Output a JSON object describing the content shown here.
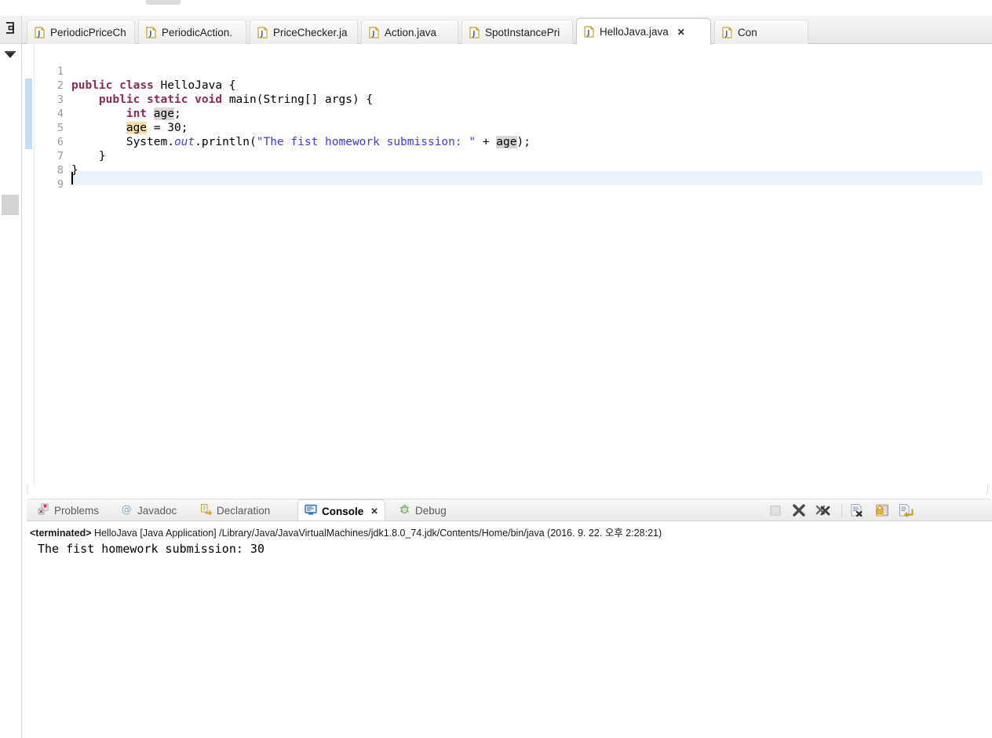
{
  "window": {
    "left_bar": {
      "restore_icon": "restore-view-icon",
      "chevron_icon": "chevron-down-icon"
    }
  },
  "editor": {
    "tabs": [
      {
        "label": "PeriodicPriceCh",
        "icon": "java-file-icon",
        "active": false,
        "closable": false
      },
      {
        "label": "PeriodicAction.",
        "icon": "java-file-icon",
        "active": false,
        "closable": false
      },
      {
        "label": "PriceChecker.ja",
        "icon": "java-file-icon",
        "active": false,
        "closable": false
      },
      {
        "label": "Action.java",
        "icon": "java-file-icon",
        "active": false,
        "closable": false
      },
      {
        "label": "SpotInstancePri",
        "icon": "java-file-icon",
        "active": false,
        "closable": false
      },
      {
        "label": "HelloJava.java",
        "icon": "java-file-icon",
        "active": true,
        "closable": true
      },
      {
        "label": "Con",
        "icon": "java-file-icon",
        "active": false,
        "closable": false
      }
    ],
    "close_glyph": "✕",
    "line_numbers": [
      "1",
      "2",
      "3",
      "4",
      "5",
      "6",
      "7",
      "8",
      "9"
    ],
    "fold_marker_line": "3",
    "code_lines": [
      "",
      "public class HelloJava {",
      "    public static void main(String[] args) {",
      "        int age;",
      "        age = 30;",
      "        System.out.println(\"The fist homework submission: \" + age);",
      "    }",
      "}",
      ""
    ],
    "current_line": "9"
  },
  "console_panel": {
    "tabs": [
      {
        "label": "Problems",
        "icon": "problems-icon",
        "active": false,
        "closable": false
      },
      {
        "label": "Javadoc",
        "icon": "javadoc-at-icon",
        "active": false,
        "closable": false
      },
      {
        "label": "Declaration",
        "icon": "declaration-icon",
        "active": false,
        "closable": false
      },
      {
        "label": "Console",
        "icon": "console-icon",
        "active": true,
        "closable": true
      },
      {
        "label": "Debug",
        "icon": "debug-bug-icon",
        "active": false,
        "closable": false
      }
    ],
    "close_glyph": "✕",
    "toolbar": [
      {
        "name": "stop-button"
      },
      {
        "name": "terminate-button"
      },
      {
        "name": "remove-all-terminated-button"
      },
      {
        "name": "clear-console-button"
      },
      {
        "name": "scroll-lock-button"
      },
      {
        "name": "pin-console-button"
      }
    ],
    "launch_label_prefix": "<terminated>",
    "launch_label": " HelloJava [Java Application] /Library/Java/JavaVirtualMachines/jdk1.8.0_74.jdk/Contents/Home/bin/java (2016. 9. 22. 오후 2:28:21)",
    "output": "The fist homework submission: 30"
  },
  "colors": {
    "keyword": "#8c2a5c",
    "string": "#3c3cdd",
    "static_field": "#4646c8",
    "occurrence_read": "#d6d6d6",
    "occurrence_write": "#f5dfaa",
    "current_line": "#eaf2fb",
    "change_bar": "#c4dcf2"
  }
}
